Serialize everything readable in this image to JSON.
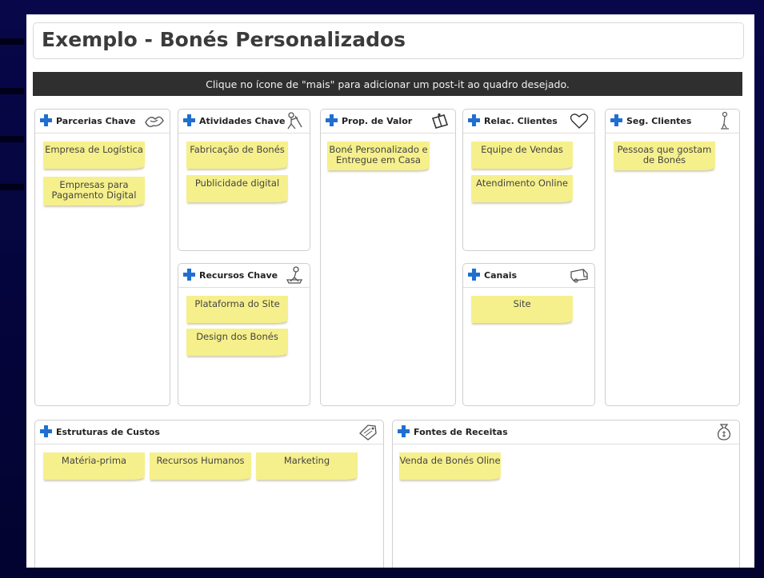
{
  "title": "Exemplo - Bonés Personalizados",
  "hint": "Clique no ícone de \"mais\" para adicionar um post-it ao quadro desejado.",
  "blocks": {
    "parcerias": {
      "title": "Parcerias Chave",
      "icon": "handshake-icon",
      "notes": [
        "Empresa de Logística",
        "Empresas para Pagamento Digital"
      ]
    },
    "atividades": {
      "title": "Atividades Chave",
      "icon": "worker-icon",
      "notes": [
        "Fabricação de Bonés",
        "Publicidade digital"
      ]
    },
    "recursos": {
      "title": "Recursos Chave",
      "icon": "resources-icon",
      "notes": [
        "Plataforma do Site",
        "Design dos Bonés"
      ]
    },
    "proposta": {
      "title": "Prop. de Valor",
      "icon": "gift-icon",
      "notes": [
        "Boné Personalizado e Entregue em Casa"
      ]
    },
    "relacionamento": {
      "title": "Relac. Clientes",
      "icon": "heart-icon",
      "notes": [
        "Equipe de Vendas",
        "Atendimento Online"
      ]
    },
    "canais": {
      "title": "Canais",
      "icon": "truck-icon",
      "notes": [
        "Site"
      ]
    },
    "segmentos": {
      "title": "Seg. Clientes",
      "icon": "person-icon",
      "notes": [
        "Pessoas que gostam de Bonés"
      ]
    },
    "custos": {
      "title": "Estruturas de Custos",
      "icon": "tag-icon",
      "notes": [
        "Matéria-prima",
        "Recursos Humanos",
        "Marketing"
      ]
    },
    "receitas": {
      "title": "Fontes de Receitas",
      "icon": "money-bag-icon",
      "notes": [
        "Venda de Bonés Oline"
      ]
    }
  },
  "colors": {
    "plus": "#1f6fd1",
    "note": "#f6f08c",
    "hint_bar": "#2f2f2f"
  }
}
